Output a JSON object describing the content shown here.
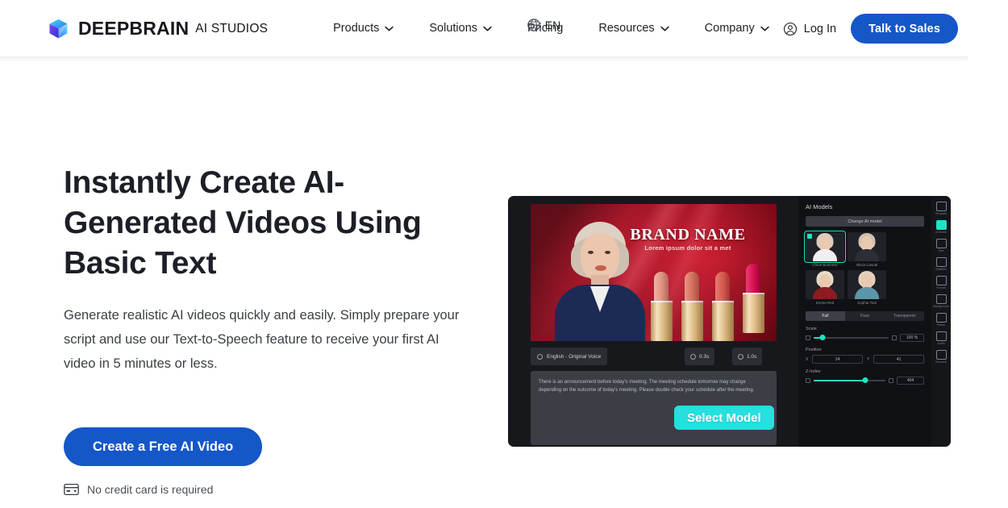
{
  "brand": {
    "name": "DEEPBRAIN",
    "suffix": "AI STUDIOS",
    "logo_icon": "cube-logo-icon",
    "logo_colors": [
      "#3ad6f0",
      "#2f6df0",
      "#7b4bf0"
    ]
  },
  "nav": {
    "items": [
      {
        "label": "Products",
        "has_dropdown": true,
        "icon": "chevron-down-icon"
      },
      {
        "label": "Solutions",
        "has_dropdown": true,
        "icon": "chevron-down-icon"
      },
      {
        "label": "Pricing",
        "has_dropdown": false,
        "icon": ""
      },
      {
        "label": "Resources",
        "has_dropdown": true,
        "icon": "chevron-down-icon"
      },
      {
        "label": "Company",
        "has_dropdown": true,
        "icon": "chevron-down-icon"
      }
    ]
  },
  "header_right": {
    "language": {
      "label": "EN",
      "icon": "globe-icon"
    },
    "login": {
      "label": "Log In",
      "icon": "user-circle-icon"
    },
    "cta": {
      "label": "Talk to Sales",
      "color": "#1557c8"
    }
  },
  "hero": {
    "headline": "Instantly Create AI-Generated Videos Using Basic Text",
    "subcopy": "Generate realistic AI videos quickly and easily. Simply prepare your script and use our Text-to-Speech feature to receive your first AI video in 5 minutes or less.",
    "cta_label": "Create a Free AI Video",
    "cta_color": "#1557c8",
    "note": "No credit card is required",
    "note_icon": "credit-card-icon"
  },
  "product_shot": {
    "stage": {
      "brand_title": "BRAND NAME",
      "brand_sub": "Lorem ipsum dolor sit a met",
      "lipstick_colors": [
        "#e0907f",
        "#d4705f",
        "#d4594f",
        "#d41050"
      ]
    },
    "toolbar": {
      "voice_label": "English - Original Voice",
      "voice_icon": "waveform-icon",
      "chips": [
        {
          "label": "0.3s",
          "icon": "clock-icon"
        },
        {
          "label": "1.0s",
          "icon": "clock-icon"
        }
      ]
    },
    "script_text": "There is an announcement before today's meeting. The meeting schedule tomorrow may change depending on the outcome of today's meeting. Please double check your schedule after the meeting.",
    "select_model_button": {
      "label": "Select Model",
      "color": "#25e0de"
    },
    "cursor_icon": "pointer-cursor-icon",
    "panel": {
      "title": "AI Models",
      "change_model_label": "Change AI model",
      "models": [
        {
          "name": "Chloe Business",
          "selected": true,
          "hair": "#d8cdbe",
          "body": "#f0f0f0"
        },
        {
          "name": "Olivia Casual",
          "selected": false,
          "hair": "#cfc2b2",
          "body": "#2b2e36"
        },
        {
          "name": "Emma Red",
          "selected": false,
          "hair": "#e8dcc6",
          "body": "#8c1b22"
        },
        {
          "name": "Sophia Teal",
          "selected": false,
          "hair": "#e3d4bb",
          "body": "#5c96a8"
        }
      ],
      "tabs": [
        {
          "label": "Full",
          "active": true
        },
        {
          "label": "Face",
          "active": false
        },
        {
          "label": "Transparent",
          "active": false
        }
      ],
      "scale": {
        "label": "Scale",
        "value": "100 %",
        "percent": 12
      },
      "position": {
        "label": "Position",
        "x_axis": "X",
        "x_value": "24",
        "y_axis": "Y",
        "y_value": "41"
      },
      "z_index": {
        "label": "Z-Index",
        "value": "404",
        "percent": 72
      }
    },
    "rail": [
      {
        "label": "Template",
        "icon": "template-icon",
        "active": false
      },
      {
        "label": "AI Model",
        "icon": "ai-model-icon",
        "active": true
      },
      {
        "label": "Text",
        "icon": "text-icon",
        "active": false
      },
      {
        "label": "Subtitles",
        "icon": "subtitles-icon",
        "active": false
      },
      {
        "label": "Format",
        "icon": "image-icon",
        "active": false
      },
      {
        "label": "Background",
        "icon": "background-icon",
        "active": false
      },
      {
        "label": "Frame",
        "icon": "frame-icon",
        "active": false
      },
      {
        "label": "Audio",
        "icon": "audio-icon",
        "active": false
      },
      {
        "label": "Element",
        "icon": "element-icon",
        "active": false
      }
    ]
  }
}
